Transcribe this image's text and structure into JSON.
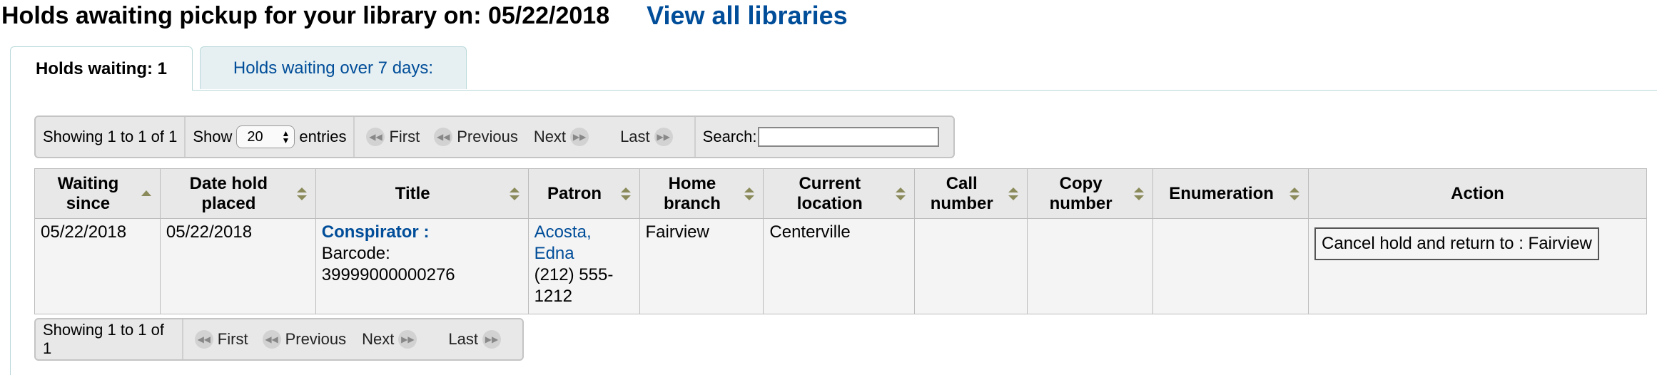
{
  "heading": {
    "title": "Holds awaiting pickup for your library on: 05/22/2018",
    "view_all": "View all libraries"
  },
  "tabs": [
    {
      "label": "Holds waiting: 1"
    },
    {
      "label": "Holds waiting over 7 days:"
    }
  ],
  "pager_top": {
    "info": "Showing 1 to 1 of 1",
    "show_label": "Show",
    "entries_value": "20",
    "entries_label": "entries",
    "first": "First",
    "previous": "Previous",
    "next": "Next",
    "last": "Last",
    "search_label": "Search:"
  },
  "pager_bottom": {
    "info": "Showing 1 to 1 of 1",
    "first": "First",
    "previous": "Previous",
    "next": "Next",
    "last": "Last"
  },
  "table": {
    "headers": [
      {
        "line1": "Waiting",
        "line2": "since"
      },
      {
        "line1": "Date hold",
        "line2": "placed"
      },
      {
        "line1": "Title",
        "line2": ""
      },
      {
        "line1": "Patron",
        "line2": ""
      },
      {
        "line1": "Home",
        "line2": "branch"
      },
      {
        "line1": "Current",
        "line2": "location"
      },
      {
        "line1": "Call",
        "line2": "number"
      },
      {
        "line1": "Copy",
        "line2": "number"
      },
      {
        "line1": "Enumeration",
        "line2": ""
      },
      {
        "line1": "Action",
        "line2": ""
      }
    ],
    "row": {
      "waiting_since": "05/22/2018",
      "date_placed": "05/22/2018",
      "title": "Conspirator :",
      "barcode_label": "Barcode:",
      "barcode": "39999000000276",
      "patron_name_1": "Acosta,",
      "patron_name_2": "Edna",
      "patron_phone_1": "(212) 555-",
      "patron_phone_2": "1212",
      "home_branch": "Fairview",
      "current_location": "Centerville",
      "call_number": "",
      "copy_number": "",
      "enumeration": "",
      "action_button": "Cancel hold and return to : Fairview"
    }
  }
}
